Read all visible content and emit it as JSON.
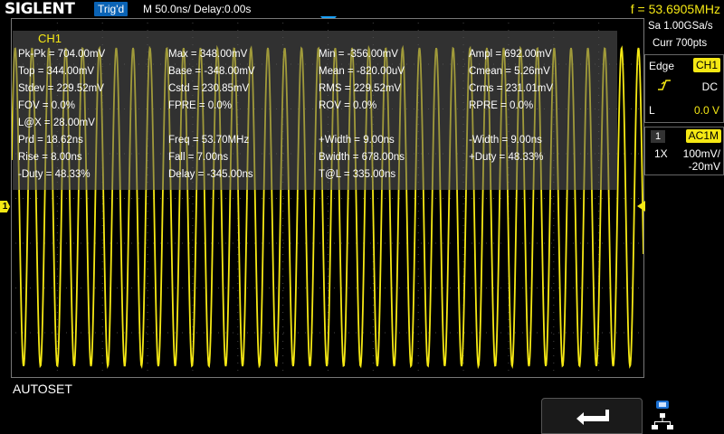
{
  "header": {
    "brand": "SIGLENT",
    "trigger_status": "Trig'd",
    "timebase": "M 50.0ns/  Delay:0.00s",
    "frequency": "f = 53.6905MHz"
  },
  "acquisition": {
    "sample_rate": "Sa 1.00GSa/s",
    "curr_points": "Curr 700pts"
  },
  "trigger": {
    "type": "Edge",
    "source": "CH1",
    "slope_icon": "rising-edge-icon",
    "coupling": "DC",
    "level_label": "L",
    "level_value": "0.0 V"
  },
  "channel": {
    "number": "1",
    "coupling": "AC1M",
    "probe": "1X",
    "volts_per_div": "100mV/",
    "offset": "-20mV"
  },
  "measurements": {
    "title": "CH1",
    "rows": [
      [
        "Pk-Pk = 704.00mV",
        "Max = 348.00mV",
        "Min = -356.00mV",
        "Ampl = 692.00mV"
      ],
      [
        "Top = 344.00mV",
        "Base = -348.00mV",
        "Mean = -820.00uV",
        "Cmean = 5.26mV"
      ],
      [
        "Stdev = 229.52mV",
        "Cstd = 230.85mV",
        "RMS = 229.52mV",
        "Crms = 231.01mV"
      ],
      [
        "FOV = 0.0%",
        "FPRE = 0.0%",
        "ROV = 0.0%",
        "RPRE = 0.0%"
      ],
      [
        "L@X = 28.00mV",
        "",
        "",
        ""
      ],
      [
        "Prd = 18.62ns",
        "Freq = 53.70MHz",
        "+Width = 9.00ns",
        "-Width = 9.00ns"
      ],
      [
        "Rise = 8.00ns",
        "Fall = 7.00ns",
        "Bwidth = 678.00ns",
        "+Duty = 48.33%"
      ],
      [
        "-Duty = 48.33%",
        "Delay = -345.00ns",
        "T@L = 335.00ns",
        ""
      ]
    ]
  },
  "waveform": {
    "channel_marker": "1",
    "cycles_visible": 37.5,
    "color": "#f5e814"
  },
  "footer": {
    "menu_label": "AUTOSET",
    "back_icon": "return-arrow-icon",
    "status_icons": [
      "usb-icon",
      "network-icon"
    ]
  },
  "colors": {
    "ch1": "#f5e814",
    "trig_badge": "#0a63b5",
    "trigger_marker": "#1aa3ff"
  }
}
